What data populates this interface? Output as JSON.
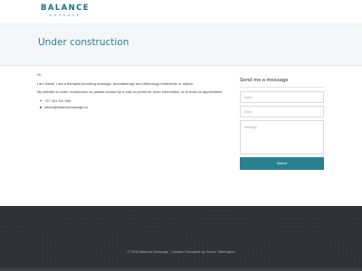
{
  "brand": {
    "name": "BALANCE",
    "tagline": "MASSAGE"
  },
  "page": {
    "title": "Under construction"
  },
  "content": {
    "greeting": "Hi,",
    "intro": "I am Sarah. I am a therapist providing massage, aromatherapy and reflexology treatments in Jaipion.",
    "notice": "My website is under construction so please contact by e-mail or phone for more information, or to book an appointment.",
    "contacts": [
      "+27 401 311 590",
      "sarah@balancemassage.co"
    ]
  },
  "contact_form": {
    "heading": "Send me a message",
    "name_placeholder": "Name",
    "email_placeholder": "Email",
    "message_placeholder": "Message",
    "submit_label": "Submit"
  },
  "footer": {
    "text": "© 2018 Balance Massage - Holistic Therapies by Sarah Titterington"
  },
  "colors": {
    "accent": "#2a8090",
    "title": "#2d7f94",
    "footer_bg": "#2e3236"
  }
}
